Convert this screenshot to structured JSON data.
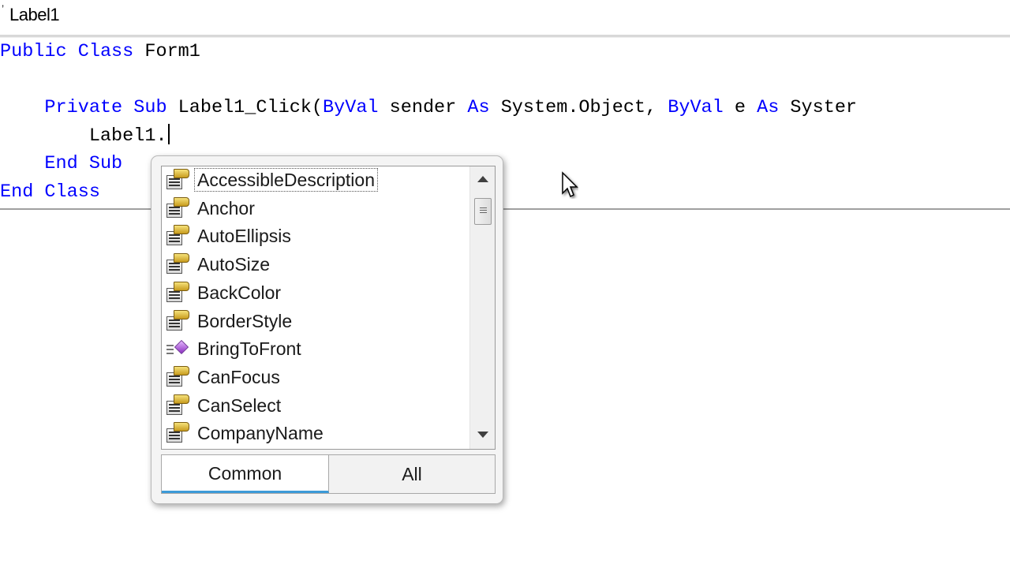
{
  "member_bar": {
    "member": "Label1"
  },
  "code": {
    "line1": {
      "kw1": "Public",
      "kw2": "Class",
      "name": "Form1"
    },
    "line3": {
      "kw1": "Private",
      "kw2": "Sub",
      "signature_start": "Label1_Click(",
      "kw3": "ByVal",
      "param1": "sender",
      "kw4": "As",
      "type1": "System.Object,",
      "kw5": "ByVal",
      "param2": "e",
      "kw6": "As",
      "type2": "Syster"
    },
    "line4": {
      "text": "Label1."
    },
    "line5": {
      "kw1": "End",
      "kw2": "Sub"
    },
    "line6": {
      "kw1": "End",
      "kw2": "Class"
    }
  },
  "intellisense": {
    "selected_index": 0,
    "items": [
      {
        "label": "AccessibleDescription",
        "icon": "property-icon"
      },
      {
        "label": "Anchor",
        "icon": "property-icon"
      },
      {
        "label": "AutoEllipsis",
        "icon": "property-icon"
      },
      {
        "label": "AutoSize",
        "icon": "property-icon"
      },
      {
        "label": "BackColor",
        "icon": "property-icon"
      },
      {
        "label": "BorderStyle",
        "icon": "property-icon"
      },
      {
        "label": "BringToFront",
        "icon": "method-icon"
      },
      {
        "label": "CanFocus",
        "icon": "property-icon"
      },
      {
        "label": "CanSelect",
        "icon": "property-icon"
      },
      {
        "label": "CompanyName",
        "icon": "property-icon"
      }
    ],
    "tabs": {
      "common": "Common",
      "all": "All"
    },
    "active_tab": "Common",
    "scroll_position": 0.05
  },
  "colors": {
    "keyword": "#0000ff",
    "text": "#000000",
    "tab_accent": "#3c9ad8"
  }
}
